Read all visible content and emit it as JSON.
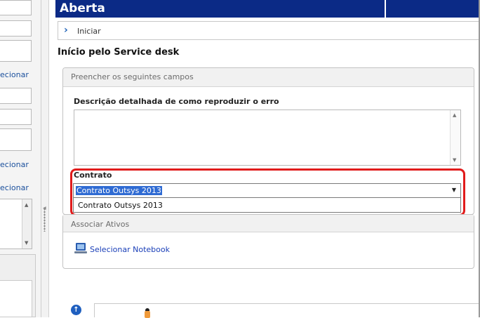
{
  "left_pane": {
    "link_1": "ecionar",
    "link_2": "ecionar",
    "link_3": "ecionar"
  },
  "header": {
    "title": "Aberta"
  },
  "breadcrumb": {
    "label": "Iniciar"
  },
  "section_title": "Início pelo Service desk",
  "panel_fields": {
    "header": "Preencher os seguintes campos",
    "description_label": "Descrição detalhada de como reproduzir o erro",
    "description_value": "",
    "contract_label": "Contrato",
    "contract_selected": "Contrato Outsys 2013",
    "contract_options": [
      "Contrato Outsys 2013"
    ]
  },
  "panel_assets": {
    "header": "Associar Ativos",
    "select_notebook": "Selecionar Notebook"
  },
  "colors": {
    "title_bar": "#0b2a86",
    "highlight": "#e11b1b",
    "selection": "#2f6bd3",
    "link": "#1a3fb8"
  }
}
